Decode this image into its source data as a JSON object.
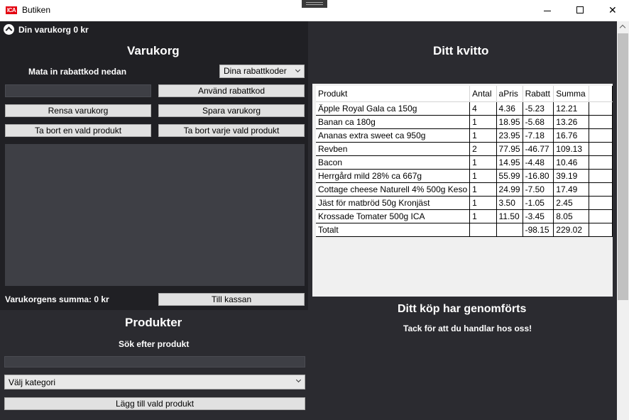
{
  "window": {
    "title": "Butiken",
    "logo_text": "ICA",
    "close_glyph": "✕"
  },
  "cart_bar": {
    "label": "Din varukorg 0 kr"
  },
  "cart": {
    "heading": "Varukorg",
    "discount_prompt": "Mata in rabattkod nedan",
    "discount_codes_dropdown": "Dina rabattkoder",
    "discount_input_value": "",
    "apply_discount": "Använd rabattkod",
    "clear_cart": "Rensa varukorg",
    "save_cart": "Spara varukorg",
    "remove_one": "Ta bort en vald produkt",
    "remove_each": "Ta bort varje vald produkt",
    "sum_label": "Varukorgens summa: 0 kr",
    "checkout": "Till kassan"
  },
  "products": {
    "heading": "Produkter",
    "search_label": "Sök efter produkt",
    "search_value": "",
    "category_dropdown": "Välj kategori",
    "add_selected": "Lägg till vald produkt"
  },
  "receipt": {
    "heading": "Ditt kvitto",
    "columns": [
      "Produkt",
      "Antal",
      "aPris",
      "Rabatt",
      "Summa"
    ],
    "rows": [
      [
        "Äpple Royal Gala ca 150g",
        "4",
        "4.36",
        "-5.23",
        "12.21"
      ],
      [
        "Banan ca 180g",
        "1",
        "18.95",
        "-5.68",
        "13.26"
      ],
      [
        "Ananas extra sweet ca 950g",
        "1",
        "23.95",
        "-7.18",
        "16.76"
      ],
      [
        "Revben",
        "2",
        "77.95",
        "-46.77",
        "109.13"
      ],
      [
        "Bacon",
        "1",
        "14.95",
        "-4.48",
        "10.46"
      ],
      [
        "Herrgård mild 28% ca 667g",
        "1",
        "55.99",
        "-16.80",
        "39.19"
      ],
      [
        "Cottage cheese Naturell 4% 500g Keso",
        "1",
        "24.99",
        "-7.50",
        "17.49"
      ],
      [
        "Jäst för matbröd 50g Kronjäst",
        "1",
        "3.50",
        "-1.05",
        "2.45"
      ],
      [
        "Krossade Tomater 500g ICA",
        "1",
        "11.50",
        "-3.45",
        "8.05"
      ],
      [
        "Totalt",
        "",
        "",
        "-98.15",
        "229.02"
      ]
    ],
    "done_heading": "Ditt köp har genomförts",
    "thanks": "Tack för att du handlar hos oss!"
  }
}
